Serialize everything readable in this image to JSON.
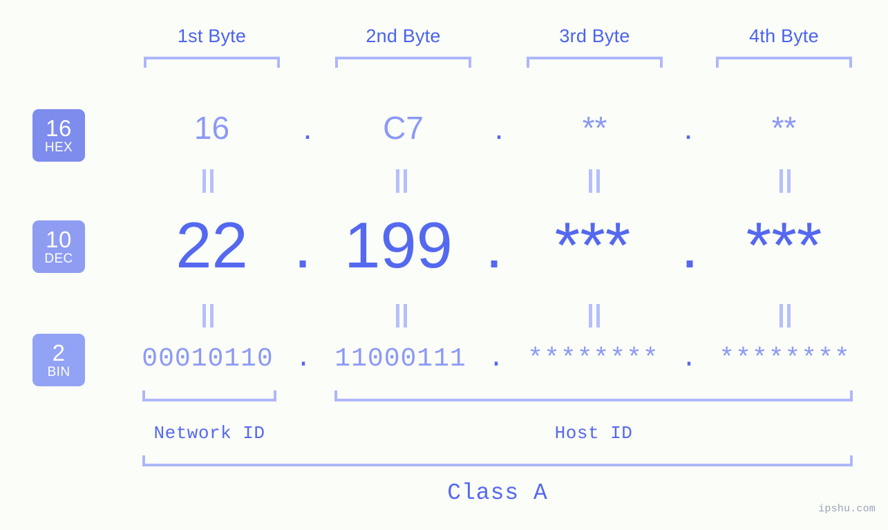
{
  "background_color": "#fbfdf8",
  "accent_color": "#5468f0",
  "accent_light_color": "#8b99f5",
  "bracket_color": "#aeb7fb",
  "badge_color": "#7d8ced",
  "header": {
    "bytes": [
      {
        "label": "1st Byte"
      },
      {
        "label": "2nd Byte"
      },
      {
        "label": "3rd Byte"
      },
      {
        "label": "4th Byte"
      }
    ]
  },
  "rows": {
    "hex": {
      "base_number": "16",
      "base_name": "HEX",
      "values": [
        "16",
        "C7",
        "**",
        "**"
      ],
      "separator": "."
    },
    "dec": {
      "base_number": "10",
      "base_name": "DEC",
      "values": [
        "22",
        "199",
        "***",
        "***"
      ],
      "separator": "."
    },
    "bin": {
      "base_number": "2",
      "base_name": "BIN",
      "values": [
        "00010110",
        "11000111",
        "********",
        "********"
      ],
      "separator": "."
    }
  },
  "equals_symbol": "=",
  "footer": {
    "network_id_label": "Network ID",
    "host_id_label": "Host ID",
    "class_label": "Class A"
  },
  "watermark": "ipshu.com"
}
